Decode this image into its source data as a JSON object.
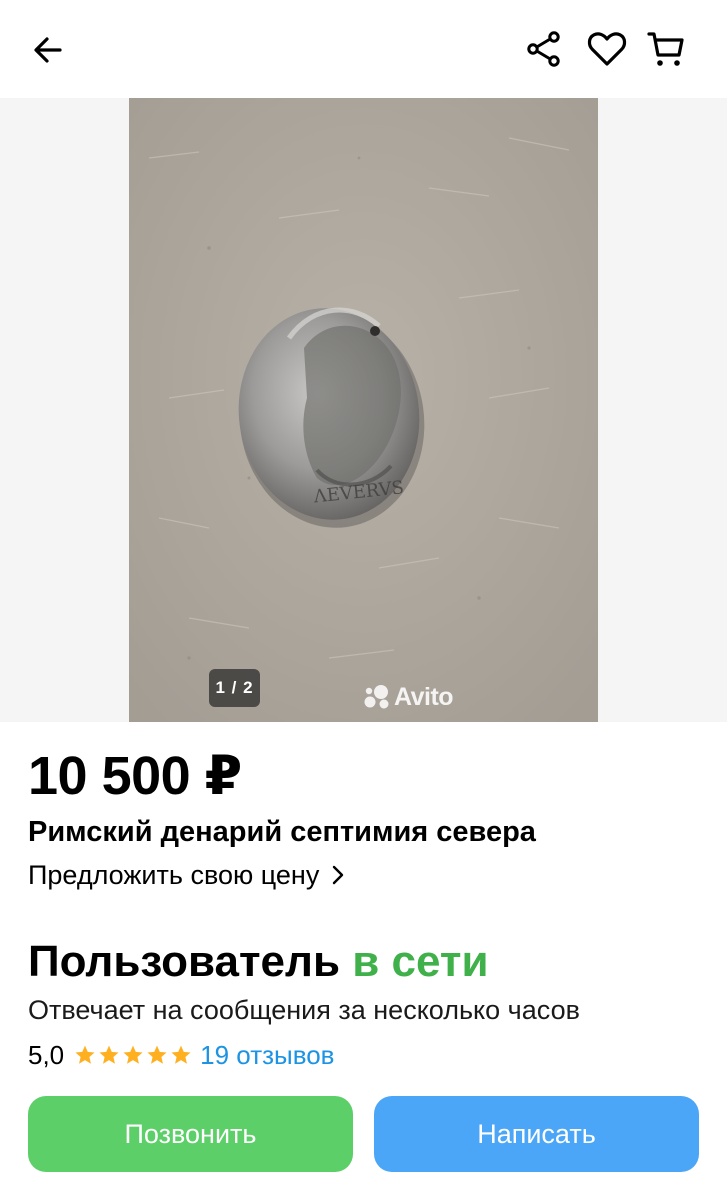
{
  "header": {
    "back_icon": "arrow-left-icon",
    "share_icon": "share-icon",
    "favorite_icon": "heart-icon",
    "cart_icon": "cart-icon"
  },
  "gallery": {
    "counter": "1 / 2",
    "current_index": 1,
    "total": 2,
    "watermark": "Avito"
  },
  "listing": {
    "price": "10 500 ₽",
    "title": "Римский денарий септимия севера",
    "offer_price_link": "Предложить свою цену"
  },
  "seller": {
    "name": "Пользователь",
    "status": "в сети",
    "reply_time": "Отвечает на сообщения за несколько часов",
    "rating": "5,0",
    "rating_value": 5,
    "rating_max": 5,
    "reviews": "19 отзывов"
  },
  "actions": {
    "call_label": "Позвонить",
    "message_label": "Написать"
  },
  "colors": {
    "online": "#3fb04a",
    "call_button": "#5ccf68",
    "message_button": "#4ba6f7",
    "link": "#1c93e3",
    "star": "#ffb021"
  }
}
